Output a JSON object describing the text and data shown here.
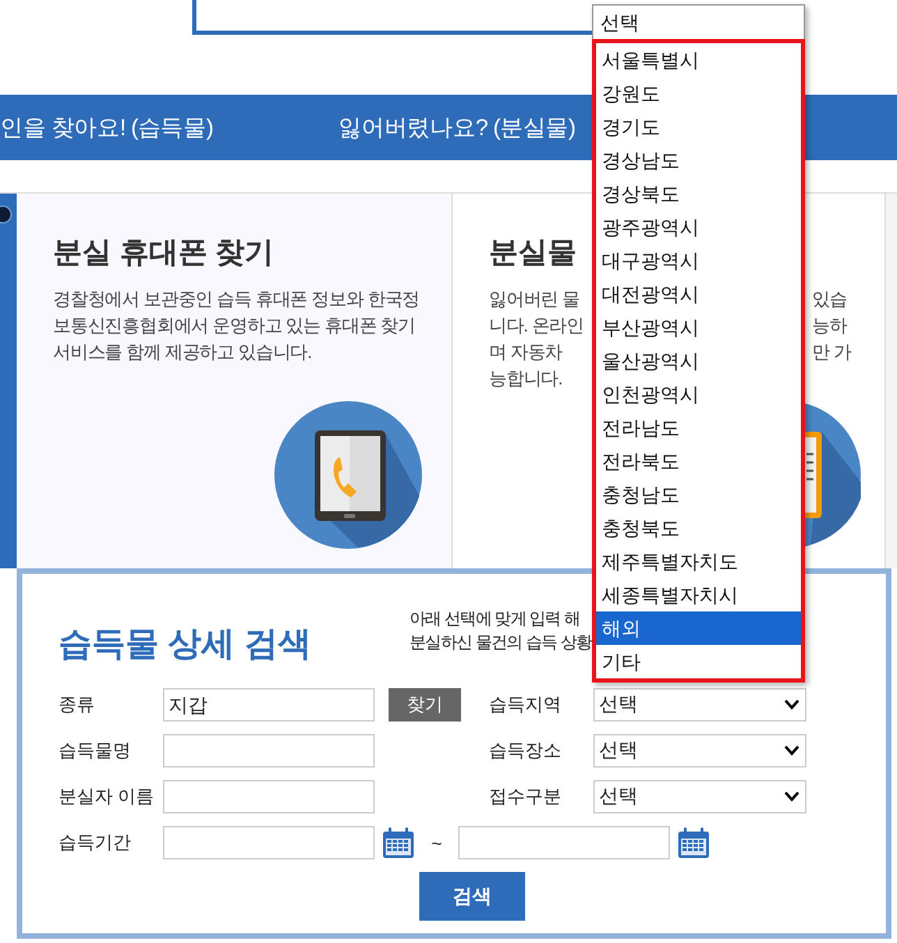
{
  "nav": {
    "links": [
      {
        "label": "인을 찾아요! (습득물)"
      },
      {
        "label": "잃어버렸나요? (분실물)"
      }
    ]
  },
  "phone_card": {
    "title": "분실 휴대폰 찾기",
    "description": "경찰청에서 보관중인 습득 휴대폰 정보와 한국정보통신진흥협회에서 운영하고 있는 휴대폰 찾기 서비스를 함께 제공하고 있습니다."
  },
  "items_card": {
    "title": "분실물",
    "lines_left": [
      "잃어버린 물",
      "니다. 온라인",
      "며 자동차",
      "능합니다."
    ],
    "lines_right": [
      "있습",
      "능하",
      "만 가"
    ]
  },
  "search": {
    "title": "습득물 상세 검색",
    "help": [
      "아래 선택에 맞게 입력 해",
      "분실하신 물건의 습득 상황"
    ],
    "left_fields": [
      {
        "label": "종류",
        "value": "지갑"
      },
      {
        "label": "습득물명"
      },
      {
        "label": "분실자 이름"
      }
    ],
    "find_button": "찾기",
    "right_fields": [
      {
        "label": "습득지역",
        "value": "선택"
      },
      {
        "label": "습득장소",
        "value": "선택"
      },
      {
        "label": "접수구분",
        "value": "선택"
      }
    ],
    "period": {
      "label": "습득기간",
      "separator": "~"
    },
    "search_button": "검색"
  },
  "dropdown": {
    "options": [
      {
        "label": "선택",
        "selected": false
      },
      {
        "label": "서울특별시",
        "selected": false
      },
      {
        "label": "강원도",
        "selected": false
      },
      {
        "label": "경기도",
        "selected": false
      },
      {
        "label": "경상남도",
        "selected": false
      },
      {
        "label": "경상북도",
        "selected": false
      },
      {
        "label": "광주광역시",
        "selected": false
      },
      {
        "label": "대구광역시",
        "selected": false
      },
      {
        "label": "대전광역시",
        "selected": false
      },
      {
        "label": "부산광역시",
        "selected": false
      },
      {
        "label": "울산광역시",
        "selected": false
      },
      {
        "label": "인천광역시",
        "selected": false
      },
      {
        "label": "전라남도",
        "selected": false
      },
      {
        "label": "전라북도",
        "selected": false
      },
      {
        "label": "충청남도",
        "selected": false
      },
      {
        "label": "충청북도",
        "selected": false
      },
      {
        "label": "제주특별자치도",
        "selected": false
      },
      {
        "label": "세종특별자치시",
        "selected": false
      },
      {
        "label": "해외",
        "selected": true
      },
      {
        "label": "기타",
        "selected": false
      }
    ]
  }
}
